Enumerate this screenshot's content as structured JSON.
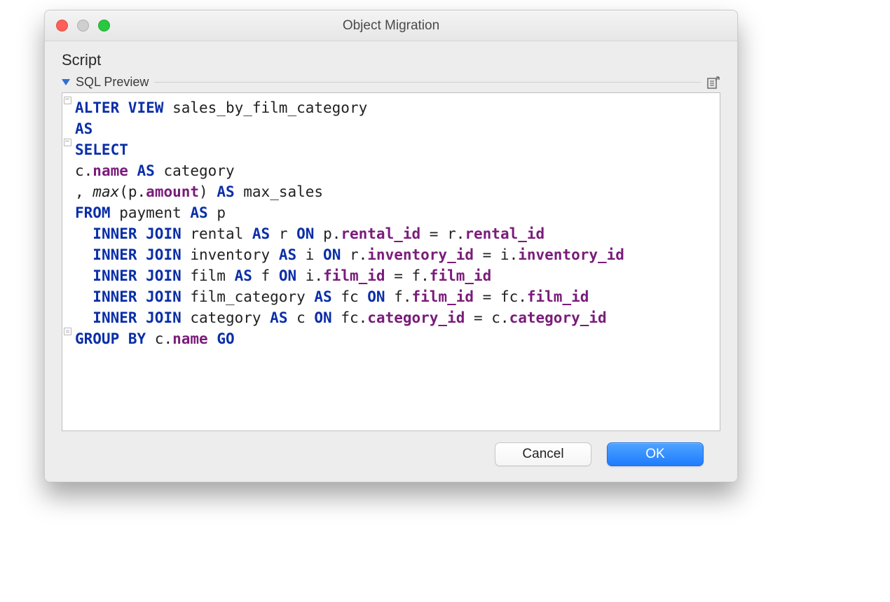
{
  "window": {
    "title": "Object Migration"
  },
  "section": {
    "heading": "Script",
    "subheading": "SQL Preview"
  },
  "sql": {
    "l1_kw1": "ALTER VIEW",
    "l1_rest": " sales_by_film_category",
    "l2_kw": "AS",
    "l3_kw": "SELECT",
    "l4_pre": "c.",
    "l4_col": "name",
    "l4_as": " AS",
    "l4_rest": " category",
    "l5_pre": ", ",
    "l5_fn": "max",
    "l5_open": "(p.",
    "l5_col": "amount",
    "l5_close": ")",
    "l5_as": " AS",
    "l5_rest": " max_sales",
    "l6_kw": "FROM",
    "l6_rest": " payment ",
    "l6_as": "AS",
    "l6_alias": " p",
    "l7_kw": "INNER JOIN",
    "l7_mid": " rental ",
    "l7_as": "AS",
    "l7_r": " r ",
    "l7_on": "ON",
    "l7_sp1": " p.",
    "l7_col1": "rental_id",
    "l7_eq": " = r.",
    "l7_col2": "rental_id",
    "l8_kw": "INNER JOIN",
    "l8_mid": " inventory ",
    "l8_as": "AS",
    "l8_r": " i ",
    "l8_on": "ON",
    "l8_sp1": " r.",
    "l8_col1": "inventory_id",
    "l8_eq": " = i.",
    "l8_col2": "inventory_id",
    "l9_kw": "INNER JOIN",
    "l9_mid": " film ",
    "l9_as": "AS",
    "l9_r": " f ",
    "l9_on": "ON",
    "l9_sp1": " i.",
    "l9_col1": "film_id",
    "l9_eq": " = f.",
    "l9_col2": "film_id",
    "l10_kw": "INNER JOIN",
    "l10_mid": " film_category ",
    "l10_as": "AS",
    "l10_r": " fc ",
    "l10_on": "ON",
    "l10_sp1": " f.",
    "l10_col1": "film_id",
    "l10_eq": " = fc.",
    "l10_col2": "film_id",
    "l11_kw": "INNER JOIN",
    "l11_mid": " category ",
    "l11_as": "AS",
    "l11_r": " c ",
    "l11_on": "ON",
    "l11_sp1": " fc.",
    "l11_col1": "category_id",
    "l11_eq": " = c.",
    "l11_col2": "category_id",
    "l12_kw": "GROUP BY",
    "l12_mid": " c.",
    "l12_col": "name",
    "l12_sp": " ",
    "l12_go": "GO"
  },
  "buttons": {
    "cancel": "Cancel",
    "ok": "OK"
  }
}
